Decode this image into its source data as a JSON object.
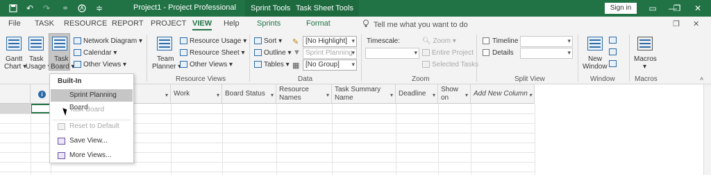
{
  "title_bar": {
    "save_icon": "save-icon",
    "undo_icon": "undo-icon",
    "redo_icon": "redo-icon",
    "link_icon": "link-icon",
    "circle_icon": "accessibility-icon",
    "customize_icon": "customize-icon",
    "document_title": "Project1 - Project Professional",
    "context_tabs": [
      "Sprint Tools",
      "Task Sheet Tools"
    ],
    "sign_in": "Sign in"
  },
  "menu_tabs": [
    "File",
    "TASK",
    "RESOURCE",
    "REPORT",
    "PROJECT",
    "VIEW",
    "Help",
    "Sprints",
    "Format"
  ],
  "active_tab": "VIEW",
  "tell_me": "Tell me what you want to do",
  "ribbon": {
    "task_views": {
      "gantt_chart": [
        "Gantt",
        "Chart ▾"
      ],
      "task_usage": [
        "Task",
        "Usage ▾"
      ],
      "task_board": [
        "Task",
        "Board ▾"
      ],
      "network_diagram": "Network Diagram ▾",
      "calendar": "Calendar ▾",
      "other_views": "Other Views ▾"
    },
    "resource_views": {
      "team_planner": [
        "Team",
        "Planner ▾"
      ],
      "resource_usage": "Resource Usage ▾",
      "resource_sheet": "Resource Sheet ▾",
      "other_views": "Other Views ▾",
      "label": "Resource Views"
    },
    "data": {
      "sort": "Sort ▾",
      "outline": "Outline ▾",
      "tables": "Tables ▾",
      "highlight": "[No Highlight]",
      "filter": "Sprint Planning",
      "group": "[No Group]",
      "label": "Data"
    },
    "zoom": {
      "timescale": "Timescale:",
      "zoom": "Zoom ▾",
      "entire_project": "Entire Project",
      "selected_tasks": "Selected Tasks",
      "label": "Zoom"
    },
    "split_view": {
      "timeline": "Timeline",
      "details": "Details",
      "label": "Split View"
    },
    "window": {
      "new_window": [
        "New",
        "Window"
      ],
      "label": "Window"
    },
    "macros": {
      "macros": [
        "Macros",
        "▾"
      ],
      "label": "Macros"
    }
  },
  "grid": {
    "columns": [
      "Work",
      "Board Status",
      "Resource Names",
      "Task Summary Name",
      "Deadline",
      "Show on",
      "Add New Column"
    ]
  },
  "task_board_menu": {
    "header": "Built-In",
    "items": [
      "Sprint Planning Board",
      "Task Board"
    ],
    "actions": [
      "Reset to Default",
      "Save View...",
      "More Views..."
    ]
  }
}
